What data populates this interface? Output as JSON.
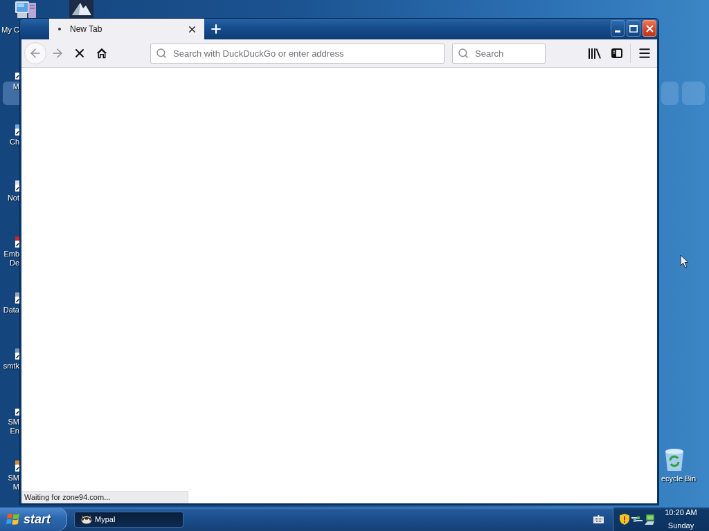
{
  "desktop": {
    "icons": [
      {
        "lines": [
          "My C"
        ],
        "selected": false
      },
      {
        "lines": [
          "M"
        ],
        "selected": true
      },
      {
        "lines": [
          "Ch"
        ],
        "selected": false
      },
      {
        "lines": [
          "Not"
        ],
        "selected": false
      },
      {
        "lines": [
          "Emb",
          "De"
        ],
        "selected": false
      },
      {
        "lines": [
          "Data"
        ],
        "selected": false
      },
      {
        "lines": [
          "smtk"
        ],
        "selected": false
      },
      {
        "lines": [
          "SM",
          "En"
        ],
        "selected": false
      },
      {
        "lines": [
          "SM",
          "M"
        ],
        "selected": false
      }
    ],
    "recycle_bin": {
      "label": "ecycle Bin"
    }
  },
  "window": {
    "tabs": [
      {
        "title": "New Tab",
        "selected": true
      }
    ],
    "navigation": {
      "back": {
        "disabled": true
      },
      "forward": {
        "disabled": true
      }
    },
    "address_bar": {
      "placeholder": "Search with DuckDuckGo or enter address"
    },
    "search_bar": {
      "placeholder": "Search"
    },
    "status": "Waiting for zone94.com..."
  },
  "taskbar": {
    "start": "start",
    "tasks": [
      {
        "label": "Mypal",
        "selected": true
      }
    ],
    "clock": {
      "time": "10:20 AM",
      "day": "Sunday"
    }
  }
}
